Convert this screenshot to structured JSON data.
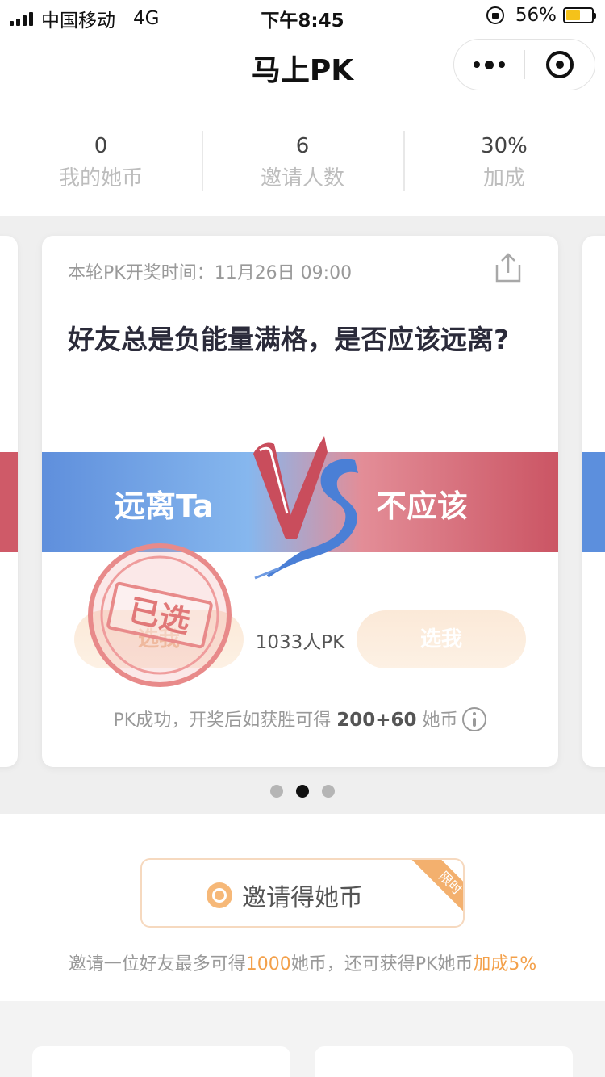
{
  "status_bar": {
    "carrier": "中国移动",
    "network": "4G",
    "time": "下午8:45",
    "battery_percent": "56%",
    "battery_level": 0.56
  },
  "nav": {
    "title": "马上PK"
  },
  "stats": [
    {
      "value": "0",
      "label": "我的她币"
    },
    {
      "value": "6",
      "label": "邀请人数"
    },
    {
      "value": "30%",
      "label": "加成"
    }
  ],
  "pk_card": {
    "draw_time": "本轮PK开奖时间：11月26日 09:00",
    "question": "好友总是负能量满格，是否应该远离?",
    "option_left": "远离Ta",
    "option_right": "不应该",
    "pick_left_label": "选我",
    "pick_right_label": "选我",
    "participants": "1033人PK",
    "stamp_text": "已选",
    "reward_prefix": "PK成功，开奖后如获胜可得 ",
    "reward_amount": "200+60",
    "reward_suffix": " 她币",
    "colors": {
      "left": "#5f8fdc",
      "right": "#cb5564"
    }
  },
  "carousel": {
    "page_count": 3,
    "active_index": 1
  },
  "invite": {
    "button_label": "邀请得她币",
    "ribbon": "限时",
    "desc_part1": "邀请一位好友最多可得",
    "desc_highlight1": "1000",
    "desc_part2": "她币，还可获得PK她币",
    "desc_highlight2": "加成5%",
    "accent_color": "#f3a04a"
  }
}
